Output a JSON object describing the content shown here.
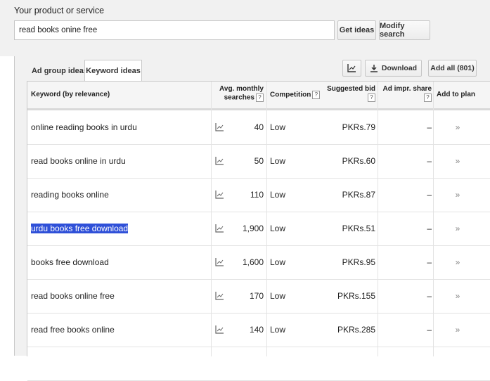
{
  "search": {
    "label": "Your product or service",
    "value": "read books onine free",
    "get_ideas": "Get ideas",
    "modify": "Modify search"
  },
  "tabs": {
    "adgroup": "Ad group ideas",
    "keyword": "Keyword ideas"
  },
  "toolbar": {
    "download": "Download",
    "add_all": "Add all (801)"
  },
  "header": {
    "keyword": "Keyword (by relevance)",
    "avg_line1": "Avg. monthly",
    "avg_line2": "searches",
    "competition": "Competition",
    "bid_line1": "Suggested bid",
    "impr": "Ad impr. share",
    "add": "Add to plan",
    "help": "?"
  },
  "rows": [
    {
      "keyword": "online reading books in urdu",
      "avg": "40",
      "competition": "Low",
      "bid": "PKRs.79",
      "impr": "–",
      "add": "»"
    },
    {
      "keyword": "read books online in urdu",
      "avg": "50",
      "competition": "Low",
      "bid": "PKRs.60",
      "impr": "–",
      "add": "»"
    },
    {
      "keyword": "reading books online",
      "avg": "110",
      "competition": "Low",
      "bid": "PKRs.87",
      "impr": "–",
      "add": "»"
    },
    {
      "keyword": "urdu books free download",
      "avg": "1,900",
      "competition": "Low",
      "bid": "PKRs.51",
      "impr": "–",
      "add": "»",
      "highlighted": true
    },
    {
      "keyword": "books free download",
      "avg": "1,600",
      "competition": "Low",
      "bid": "PKRs.95",
      "impr": "–",
      "add": "»"
    },
    {
      "keyword": "read books online free",
      "avg": "170",
      "competition": "Low",
      "bid": "PKRs.155",
      "impr": "–",
      "add": "»"
    },
    {
      "keyword": "read free books online",
      "avg": "140",
      "competition": "Low",
      "bid": "PKRs.285",
      "impr": "–",
      "add": "»"
    }
  ],
  "colors": {
    "highlight": "#2f50d8",
    "panel_bg": "#f1f1f1"
  },
  "icons": {
    "chart": "trend-chart-icon",
    "download": "download-icon",
    "add": "double-chevron-right-icon"
  }
}
